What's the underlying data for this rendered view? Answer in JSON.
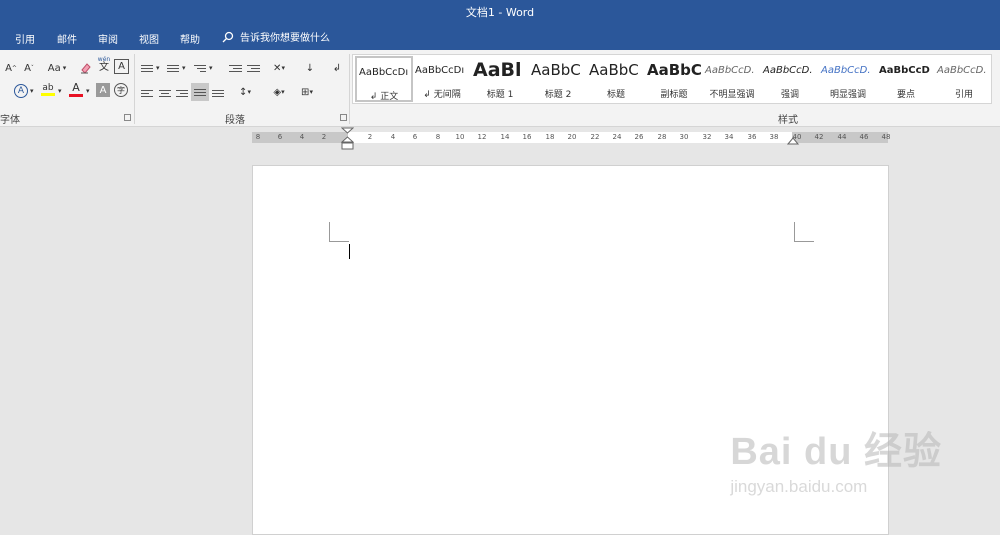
{
  "window": {
    "title": "文档1  -  Word"
  },
  "menu": {
    "items": [
      "引用",
      "邮件",
      "审阅",
      "视图",
      "帮助"
    ],
    "tell_me": "告诉我你想要做什么"
  },
  "ribbon": {
    "font_group": {
      "label": "字体",
      "change_case": "Aa",
      "phonetic_top": "wén",
      "phonetic_bottom": "文",
      "char_border": "A",
      "font_color_letter": "A",
      "shading_letter": "A"
    },
    "paragraph_group": {
      "label": "段落"
    },
    "styles_group": {
      "label": "样式",
      "items": [
        {
          "sample": "AaBbCcDı",
          "name": "↲ 正文",
          "selected": true
        },
        {
          "sample": "AaBbCcDı",
          "name": "↲ 无间隔",
          "selected": false
        },
        {
          "sample": "AaBl",
          "name": "标题 1",
          "selected": false
        },
        {
          "sample": "AaBbC",
          "name": "标题 2",
          "selected": false
        },
        {
          "sample": "AaBbC",
          "name": "标题",
          "selected": false
        },
        {
          "sample": "AaBbC",
          "name": "副标题",
          "selected": false
        },
        {
          "sample": "AaBbCcD.",
          "name": "不明显强调",
          "selected": false
        },
        {
          "sample": "AaBbCcD.",
          "name": "强调",
          "selected": false
        },
        {
          "sample": "AaBbCcD.",
          "name": "明显强调",
          "selected": false
        },
        {
          "sample": "AaBbCcD",
          "name": "要点",
          "selected": false
        },
        {
          "sample": "AaBbCcD.",
          "name": "引用",
          "selected": false
        }
      ]
    }
  },
  "ruler": {
    "left_numbers": [
      "8",
      "6",
      "4",
      "2"
    ],
    "right_numbers": [
      "2",
      "4",
      "6",
      "8",
      "10",
      "12",
      "14",
      "16",
      "18",
      "20",
      "22",
      "24",
      "26",
      "28",
      "30",
      "32",
      "34",
      "36",
      "38",
      "40",
      "42",
      "44",
      "46",
      "48"
    ]
  },
  "watermark": {
    "brand": "Bai du 经验",
    "url": "jingyan.baidu.com"
  },
  "colors": {
    "titlebar": "#2b579a",
    "font_color": "#e81123",
    "highlight": "#ffff00",
    "intense_emphasis": "#4472c4"
  }
}
